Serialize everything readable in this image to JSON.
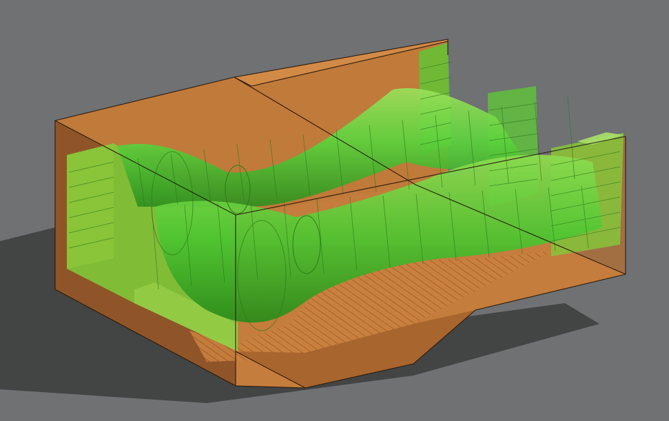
{
  "viewport": {
    "background_color": "#6f7173",
    "shadow_color": "#3c3c3c"
  },
  "model": {
    "housing_color": "#c07a3a",
    "housing_dark_color": "#8f5528",
    "housing_light_color": "#d28a47",
    "edge_color": "#2a1a0d",
    "channel_color": "#58c63a",
    "channel_light_color": "#9be05a",
    "channel_dark_color": "#2f8e1e",
    "mesh_line_color": "#2d7a1a"
  }
}
